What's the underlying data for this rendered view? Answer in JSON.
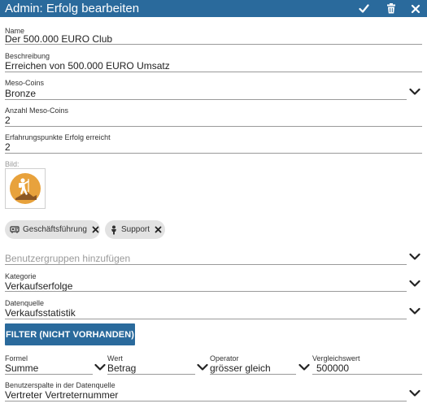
{
  "window": {
    "title": "Admin: Erfolg bearbeiten"
  },
  "icons": {
    "confirm": "check-icon",
    "delete": "trash-icon",
    "close": "close-icon"
  },
  "form": {
    "name": {
      "label": "Name",
      "value": "Der 500.000 EURO Club"
    },
    "beschreibung": {
      "label": "Beschreibung",
      "value": "Erreichen von 500.000 EURO Umsatz"
    },
    "meso_coins": {
      "label": "Meso-Coins",
      "value": "Bronze"
    },
    "anzahl_meso_coins": {
      "label": "Anzahl Meso-Coins",
      "value": "2"
    },
    "erfahrungspunkte": {
      "label": "Erfahrungspunkte Erfolg erreicht",
      "value": "2"
    },
    "bild": {
      "label": "Bild:"
    },
    "chips": [
      {
        "label": "Geschäftsführung",
        "icon": "group-icon"
      },
      {
        "label": "Support",
        "icon": "person-icon"
      }
    ],
    "benutzergruppen": {
      "placeholder": "Benutzergruppen hinzufügen"
    },
    "kategorie": {
      "label": "Kategorie",
      "value": "Verkaufserfolge"
    },
    "datenquelle": {
      "label": "Datenquelle",
      "value": "Verkaufsstatistik"
    },
    "filter_button": "FILTER (NICHT VORHANDEN)",
    "formel": {
      "label": "Formel",
      "value": "Summe"
    },
    "wert": {
      "label": "Wert",
      "value": "Betrag"
    },
    "operator": {
      "label": "Operator",
      "value": "grösser gleich"
    },
    "vergleichswert": {
      "label": "Vergleichswert",
      "value": "500000"
    },
    "benutzerspalte": {
      "label": "Benutzerspalte in der Datenquelle",
      "value": "Vertreter Vertreternummer"
    }
  },
  "colors": {
    "primary": "#2a6a9c",
    "chip_bg": "#e2e2e2",
    "image_circle": "#e8a23c"
  }
}
